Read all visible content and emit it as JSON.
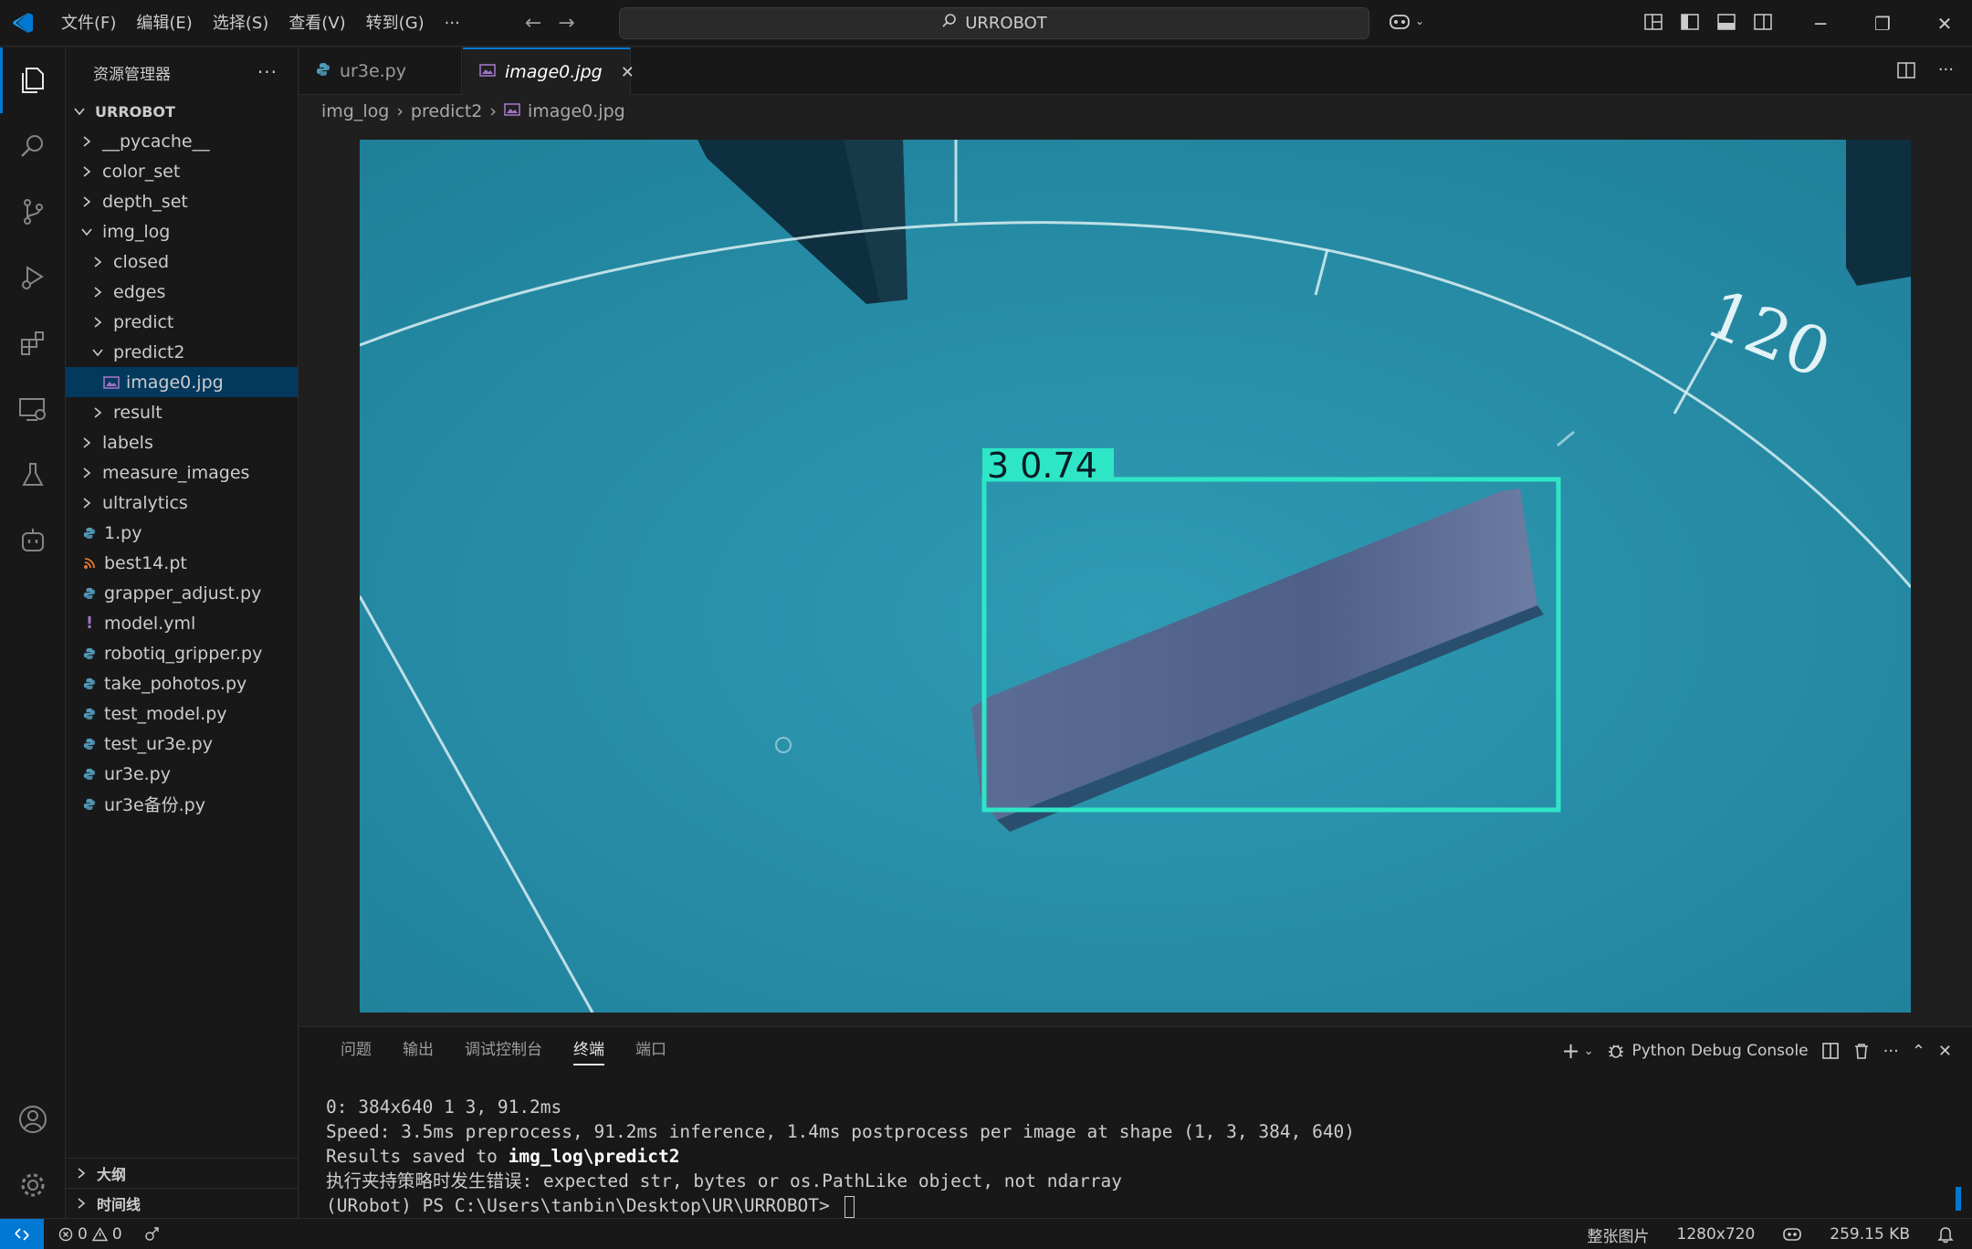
{
  "titlebar": {
    "menus": [
      "文件(F)",
      "编辑(E)",
      "选择(S)",
      "查看(V)",
      "转到(G)",
      "···"
    ],
    "search_text": "URROBOT"
  },
  "sidebar": {
    "title": "资源管理器",
    "more": "···",
    "root": "URROBOT",
    "items": [
      {
        "label": "__pycache__",
        "type": "folder",
        "depth": 1,
        "expanded": false
      },
      {
        "label": "color_set",
        "type": "folder",
        "depth": 1,
        "expanded": false
      },
      {
        "label": "depth_set",
        "type": "folder",
        "depth": 1,
        "expanded": false
      },
      {
        "label": "img_log",
        "type": "folder",
        "depth": 1,
        "expanded": true
      },
      {
        "label": "closed",
        "type": "folder",
        "depth": 2,
        "expanded": false
      },
      {
        "label": "edges",
        "type": "folder",
        "depth": 2,
        "expanded": false
      },
      {
        "label": "predict",
        "type": "folder",
        "depth": 2,
        "expanded": false
      },
      {
        "label": "predict2",
        "type": "folder",
        "depth": 2,
        "expanded": true
      },
      {
        "label": "image0.jpg",
        "type": "image",
        "depth": 3,
        "selected": true
      },
      {
        "label": "result",
        "type": "folder",
        "depth": 2,
        "expanded": false
      },
      {
        "label": "labels",
        "type": "folder",
        "depth": 1,
        "expanded": false
      },
      {
        "label": "measure_images",
        "type": "folder",
        "depth": 1,
        "expanded": false
      },
      {
        "label": "ultralytics",
        "type": "folder",
        "depth": 1,
        "expanded": false
      },
      {
        "label": "1.py",
        "type": "python",
        "depth": 1
      },
      {
        "label": "best14.pt",
        "type": "rss",
        "depth": 1
      },
      {
        "label": "grapper_adjust.py",
        "type": "python",
        "depth": 1
      },
      {
        "label": "model.yml",
        "type": "yaml",
        "depth": 1
      },
      {
        "label": "robotiq_gripper.py",
        "type": "python",
        "depth": 1
      },
      {
        "label": "take_pohotos.py",
        "type": "python",
        "depth": 1
      },
      {
        "label": "test_model.py",
        "type": "python",
        "depth": 1
      },
      {
        "label": "test_ur3e.py",
        "type": "python",
        "depth": 1
      },
      {
        "label": "ur3e.py",
        "type": "python",
        "depth": 1
      },
      {
        "label": "ur3e备份.py",
        "type": "python",
        "depth": 1
      }
    ],
    "outline": "大纲",
    "timeline": "时间线"
  },
  "tabs": [
    {
      "label": "ur3e.py",
      "active": false
    },
    {
      "label": "image0.jpg",
      "active": true
    }
  ],
  "breadcrumb": [
    "img_log",
    "predict2",
    "image0.jpg"
  ],
  "image": {
    "detection_label": "3 0.74",
    "dial_mark": "120"
  },
  "panel": {
    "tabs": [
      "问题",
      "输出",
      "调试控制台",
      "终端",
      "端口"
    ],
    "active_tab": "终端",
    "console_name": "Python Debug Console",
    "terminal_lines": [
      "0: 384x640 1 3, 91.2ms",
      "Speed: 3.5ms preprocess, 91.2ms inference, 1.4ms postprocess per image at shape (1, 3, 384, 640)",
      "Results saved to ",
      "img_log\\predict2",
      "执行夹持策略时发生错误: expected str, bytes or os.PathLike object, not ndarray",
      "(URobot) PS C:\\Users\\tanbin\\Desktop\\UR\\URROBOT> "
    ]
  },
  "statusbar": {
    "errors": "0",
    "warnings": "0",
    "mode": "整张图片",
    "dimensions": "1280x720",
    "size": "259.15 KB"
  },
  "colors": {
    "accent": "#0078d4",
    "detection_box": "#2ee6c6",
    "image_bg": "#2a93ad"
  }
}
